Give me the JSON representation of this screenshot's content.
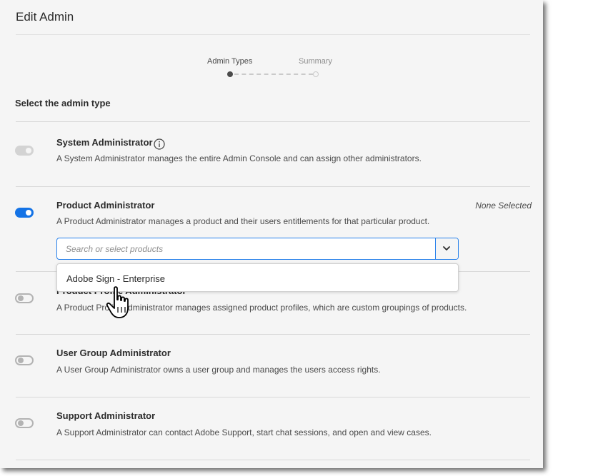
{
  "header": {
    "title": "Edit Admin"
  },
  "steps": [
    {
      "label": "Admin Types",
      "state": "active"
    },
    {
      "label": "Summary",
      "state": "inactive"
    }
  ],
  "section_title": "Select the admin type",
  "admin_types": [
    {
      "title": "System Administrator",
      "description": "A System Administrator manages the entire Admin Console and can assign other administrators.",
      "toggle": "on-disabled",
      "has_info_icon": true
    },
    {
      "title": "Product Administrator",
      "description": "A Product Administrator manages a product and their users entitlements for that particular product.",
      "toggle": "on",
      "status": "None Selected"
    },
    {
      "title": "Product Profile Administrator",
      "description": "A Product Profile Administrator manages assigned product profiles, which are custom groupings of products.",
      "toggle": "off"
    },
    {
      "title": "User Group Administrator",
      "description": "A User Group Administrator owns a user group and manages the users access rights.",
      "toggle": "off"
    },
    {
      "title": "Support Administrator",
      "description": "A Support Administrator can contact Adobe Support, start chat sessions, and open and view cases.",
      "toggle": "off"
    }
  ],
  "product_search": {
    "placeholder": "Search or select products",
    "value": "",
    "dropdown_icon": "chevron-down-icon",
    "options": [
      "Adobe Sign - Enterprise"
    ]
  },
  "colors": {
    "accent": "#1473e6",
    "panel_background": "#f5f5f5",
    "text": "#2c2c2c"
  },
  "cursor_icon": "hand-pointer-icon"
}
